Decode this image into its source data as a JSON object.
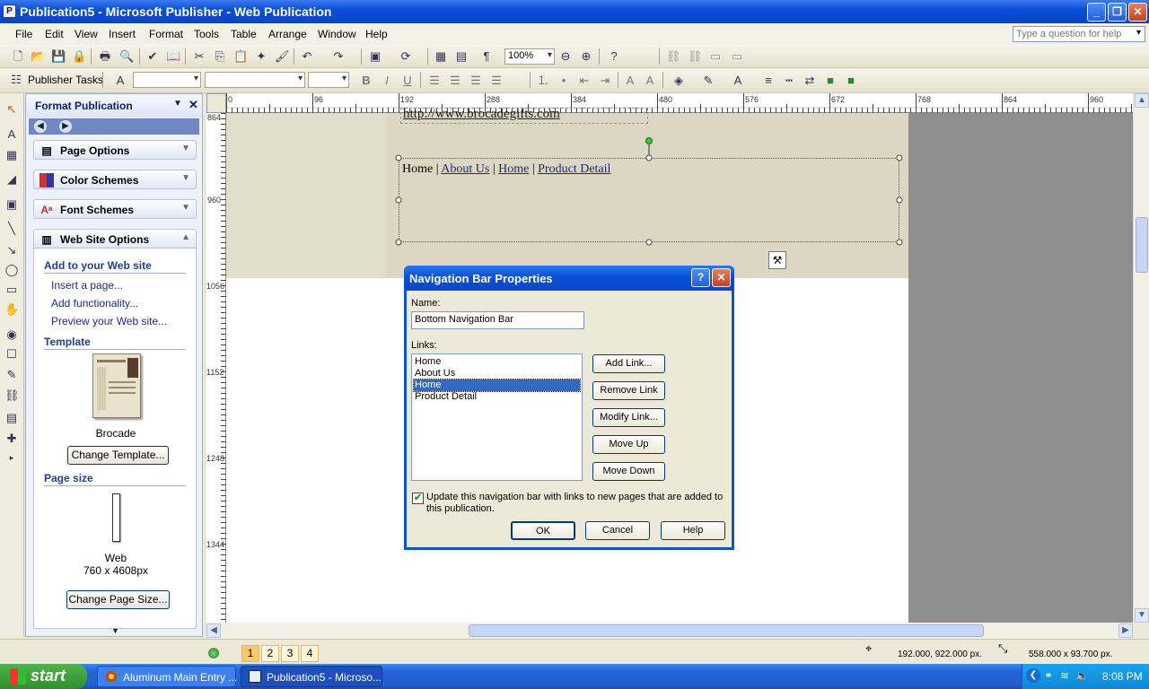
{
  "window": {
    "title": "Publication5 - Microsoft Publisher - Web Publication",
    "app_icon": "publisher-icon"
  },
  "menu": [
    "File",
    "Edit",
    "View",
    "Insert",
    "Format",
    "Tools",
    "Table",
    "Arrange",
    "Window",
    "Help"
  ],
  "help_placeholder": "Type a question for help",
  "toolbar": {
    "zoom": "100%",
    "publisher_tasks": "Publisher Tasks"
  },
  "taskpane": {
    "title": "Format Publication",
    "sections": [
      "Page Options",
      "Color Schemes",
      "Font Schemes",
      "Web Site Options"
    ],
    "add_header": "Add to your Web site",
    "links": [
      "Insert a page...",
      "Add functionality...",
      "Preview your Web site..."
    ],
    "template_header": "Template",
    "template_name": "Brocade",
    "change_template": "Change Template...",
    "page_size_header": "Page size",
    "page_size_name": "Web",
    "page_size_dims": "760 x 4608px",
    "change_page_size": "Change Page Size..."
  },
  "ruler": {
    "h": [
      "0",
      "96",
      "192",
      "288",
      "384",
      "480",
      "576",
      "672",
      "768",
      "864",
      "960"
    ],
    "v": [
      "864",
      "960",
      "1056",
      "1152",
      "1248",
      "1344"
    ]
  },
  "canvas": {
    "url_text": "http://www.brocadegifts.com",
    "nav_links": [
      "Home",
      "About Us",
      "Home",
      "Product Detail"
    ]
  },
  "dialog": {
    "title": "Navigation Bar Properties",
    "name_label": "Name:",
    "name_value": "Bottom Navigation Bar",
    "links_label": "Links:",
    "links": [
      "Home",
      "About Us",
      "Home",
      "Product Detail"
    ],
    "selected_index": 2,
    "buttons": [
      "Add Link...",
      "Remove Link",
      "Modify Link...",
      "Move Up",
      "Move Down"
    ],
    "checkbox_label": "Update this navigation bar with links to new pages that are added to this publication.",
    "checkbox_checked": true,
    "ok": "OK",
    "cancel": "Cancel",
    "help": "Help"
  },
  "status": {
    "pages": [
      "1",
      "2",
      "3",
      "4"
    ],
    "active_page": "1",
    "position": "192.000, 922.000 px.",
    "size": "558.000 x 93.700 px."
  },
  "taskbar": {
    "start": "start",
    "items": [
      "Aluminum Main Entry ...",
      "Publication5 - Microso..."
    ],
    "clock": "8:08 PM"
  },
  "colors": {
    "xp_blue": "#0a4fd8",
    "page_bg": "#e3ddcc",
    "selected": "#316ac5"
  }
}
